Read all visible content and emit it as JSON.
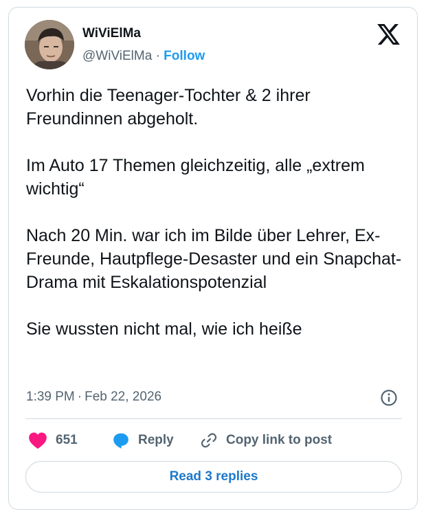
{
  "author": {
    "display_name": "WiViElMa",
    "handle": "@WiViElMa",
    "separator": "·",
    "follow_label": "Follow"
  },
  "tweet": {
    "paragraphs": [
      "Vorhin die Teenager-Tochter & 2 ihrer Freundinnen abgeholt.",
      "Im Auto 17 Themen gleichzeitig, alle „extrem wichtig“",
      "Nach 20 Min. war ich im Bilde über Lehrer, Ex-Freunde, Hautpflege-Desaster und ein Snapchat-Drama mit Eskalationspotenzial",
      "Sie wussten nicht mal, wie ich heiße"
    ],
    "time": "1:39 PM",
    "date_separator": "·",
    "date": "Feb 22, 2026"
  },
  "actions": {
    "like_count": "651",
    "reply_label": "Reply",
    "copy_link_label": "Copy link to post",
    "read_replies_label": "Read 3 replies"
  },
  "icons": {
    "brand": "x-logo-icon",
    "info": "info-icon",
    "like": "heart-icon",
    "reply": "speech-bubble-icon",
    "copy": "link-icon"
  },
  "colors": {
    "accent": "#1d9bf0",
    "like": "#f91880",
    "reply_icon": "#1d9bf0",
    "text_primary": "#0f1419",
    "text_secondary": "#536471",
    "border": "#cfd9de"
  }
}
